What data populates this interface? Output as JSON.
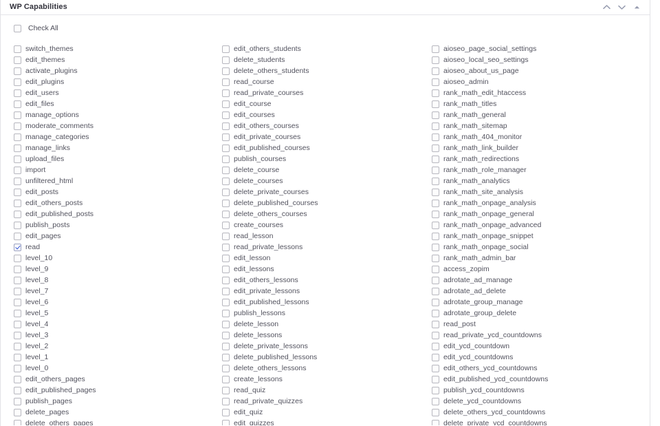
{
  "panel": {
    "title": "WP Capabilities",
    "header_icons": [
      {
        "name": "chevron-up-icon",
        "label": "Move up"
      },
      {
        "name": "chevron-down-icon",
        "label": "Move down"
      },
      {
        "name": "collapse-icon",
        "label": "Collapse"
      }
    ]
  },
  "check_all": {
    "label": "Check All",
    "checked": false
  },
  "columns": [
    {
      "id": "column-1",
      "items": [
        {
          "label": "switch_themes",
          "checked": false
        },
        {
          "label": "edit_themes",
          "checked": false
        },
        {
          "label": "activate_plugins",
          "checked": false
        },
        {
          "label": "edit_plugins",
          "checked": false
        },
        {
          "label": "edit_users",
          "checked": false
        },
        {
          "label": "edit_files",
          "checked": false
        },
        {
          "label": "manage_options",
          "checked": false
        },
        {
          "label": "moderate_comments",
          "checked": false
        },
        {
          "label": "manage_categories",
          "checked": false
        },
        {
          "label": "manage_links",
          "checked": false
        },
        {
          "label": "upload_files",
          "checked": false
        },
        {
          "label": "import",
          "checked": false
        },
        {
          "label": "unfiltered_html",
          "checked": false
        },
        {
          "label": "edit_posts",
          "checked": false
        },
        {
          "label": "edit_others_posts",
          "checked": false
        },
        {
          "label": "edit_published_posts",
          "checked": false
        },
        {
          "label": "publish_posts",
          "checked": false
        },
        {
          "label": "edit_pages",
          "checked": false
        },
        {
          "label": "read",
          "checked": true
        },
        {
          "label": "level_10",
          "checked": false
        },
        {
          "label": "level_9",
          "checked": false
        },
        {
          "label": "level_8",
          "checked": false
        },
        {
          "label": "level_7",
          "checked": false
        },
        {
          "label": "level_6",
          "checked": false
        },
        {
          "label": "level_5",
          "checked": false
        },
        {
          "label": "level_4",
          "checked": false
        },
        {
          "label": "level_3",
          "checked": false
        },
        {
          "label": "level_2",
          "checked": false
        },
        {
          "label": "level_1",
          "checked": false
        },
        {
          "label": "level_0",
          "checked": false
        },
        {
          "label": "edit_others_pages",
          "checked": false
        },
        {
          "label": "edit_published_pages",
          "checked": false
        },
        {
          "label": "publish_pages",
          "checked": false
        },
        {
          "label": "delete_pages",
          "checked": false
        },
        {
          "label": "delete_others_pages",
          "checked": false
        }
      ]
    },
    {
      "id": "column-2",
      "items": [
        {
          "label": "edit_others_students",
          "checked": false
        },
        {
          "label": "delete_students",
          "checked": false
        },
        {
          "label": "delete_others_students",
          "checked": false
        },
        {
          "label": "read_course",
          "checked": false
        },
        {
          "label": "read_private_courses",
          "checked": false
        },
        {
          "label": "edit_course",
          "checked": false
        },
        {
          "label": "edit_courses",
          "checked": false
        },
        {
          "label": "edit_others_courses",
          "checked": false
        },
        {
          "label": "edit_private_courses",
          "checked": false
        },
        {
          "label": "edit_published_courses",
          "checked": false
        },
        {
          "label": "publish_courses",
          "checked": false
        },
        {
          "label": "delete_course",
          "checked": false
        },
        {
          "label": "delete_courses",
          "checked": false
        },
        {
          "label": "delete_private_courses",
          "checked": false
        },
        {
          "label": "delete_published_courses",
          "checked": false
        },
        {
          "label": "delete_others_courses",
          "checked": false
        },
        {
          "label": "create_courses",
          "checked": false
        },
        {
          "label": "read_lesson",
          "checked": false
        },
        {
          "label": "read_private_lessons",
          "checked": false
        },
        {
          "label": "edit_lesson",
          "checked": false
        },
        {
          "label": "edit_lessons",
          "checked": false
        },
        {
          "label": "edit_others_lessons",
          "checked": false
        },
        {
          "label": "edit_private_lessons",
          "checked": false
        },
        {
          "label": "edit_published_lessons",
          "checked": false
        },
        {
          "label": "publish_lessons",
          "checked": false
        },
        {
          "label": "delete_lesson",
          "checked": false
        },
        {
          "label": "delete_lessons",
          "checked": false
        },
        {
          "label": "delete_private_lessons",
          "checked": false
        },
        {
          "label": "delete_published_lessons",
          "checked": false
        },
        {
          "label": "delete_others_lessons",
          "checked": false
        },
        {
          "label": "create_lessons",
          "checked": false
        },
        {
          "label": "read_quiz",
          "checked": false
        },
        {
          "label": "read_private_quizzes",
          "checked": false
        },
        {
          "label": "edit_quiz",
          "checked": false
        },
        {
          "label": "edit_quizzes",
          "checked": false
        }
      ]
    },
    {
      "id": "column-3",
      "items": [
        {
          "label": "aioseo_page_social_settings",
          "checked": false
        },
        {
          "label": "aioseo_local_seo_settings",
          "checked": false
        },
        {
          "label": "aioseo_about_us_page",
          "checked": false
        },
        {
          "label": "aioseo_admin",
          "checked": false
        },
        {
          "label": "rank_math_edit_htaccess",
          "checked": false
        },
        {
          "label": "rank_math_titles",
          "checked": false
        },
        {
          "label": "rank_math_general",
          "checked": false
        },
        {
          "label": "rank_math_sitemap",
          "checked": false
        },
        {
          "label": "rank_math_404_monitor",
          "checked": false
        },
        {
          "label": "rank_math_link_builder",
          "checked": false
        },
        {
          "label": "rank_math_redirections",
          "checked": false
        },
        {
          "label": "rank_math_role_manager",
          "checked": false
        },
        {
          "label": "rank_math_analytics",
          "checked": false
        },
        {
          "label": "rank_math_site_analysis",
          "checked": false
        },
        {
          "label": "rank_math_onpage_analysis",
          "checked": false
        },
        {
          "label": "rank_math_onpage_general",
          "checked": false
        },
        {
          "label": "rank_math_onpage_advanced",
          "checked": false
        },
        {
          "label": "rank_math_onpage_snippet",
          "checked": false
        },
        {
          "label": "rank_math_onpage_social",
          "checked": false
        },
        {
          "label": "rank_math_admin_bar",
          "checked": false
        },
        {
          "label": "access_zopim",
          "checked": false
        },
        {
          "label": "adrotate_ad_manage",
          "checked": false
        },
        {
          "label": "adrotate_ad_delete",
          "checked": false
        },
        {
          "label": "adrotate_group_manage",
          "checked": false
        },
        {
          "label": "adrotate_group_delete",
          "checked": false
        },
        {
          "label": "read_post",
          "checked": false
        },
        {
          "label": "read_private_ycd_countdowns",
          "checked": false
        },
        {
          "label": "edit_ycd_countdown",
          "checked": false
        },
        {
          "label": "edit_ycd_countdowns",
          "checked": false
        },
        {
          "label": "edit_others_ycd_countdowns",
          "checked": false
        },
        {
          "label": "edit_published_ycd_countdowns",
          "checked": false
        },
        {
          "label": "publish_ycd_countdowns",
          "checked": false
        },
        {
          "label": "delete_ycd_countdowns",
          "checked": false
        },
        {
          "label": "delete_others_ycd_countdowns",
          "checked": false
        },
        {
          "label": "delete_private_ycd_countdowns",
          "checked": false
        }
      ]
    }
  ]
}
